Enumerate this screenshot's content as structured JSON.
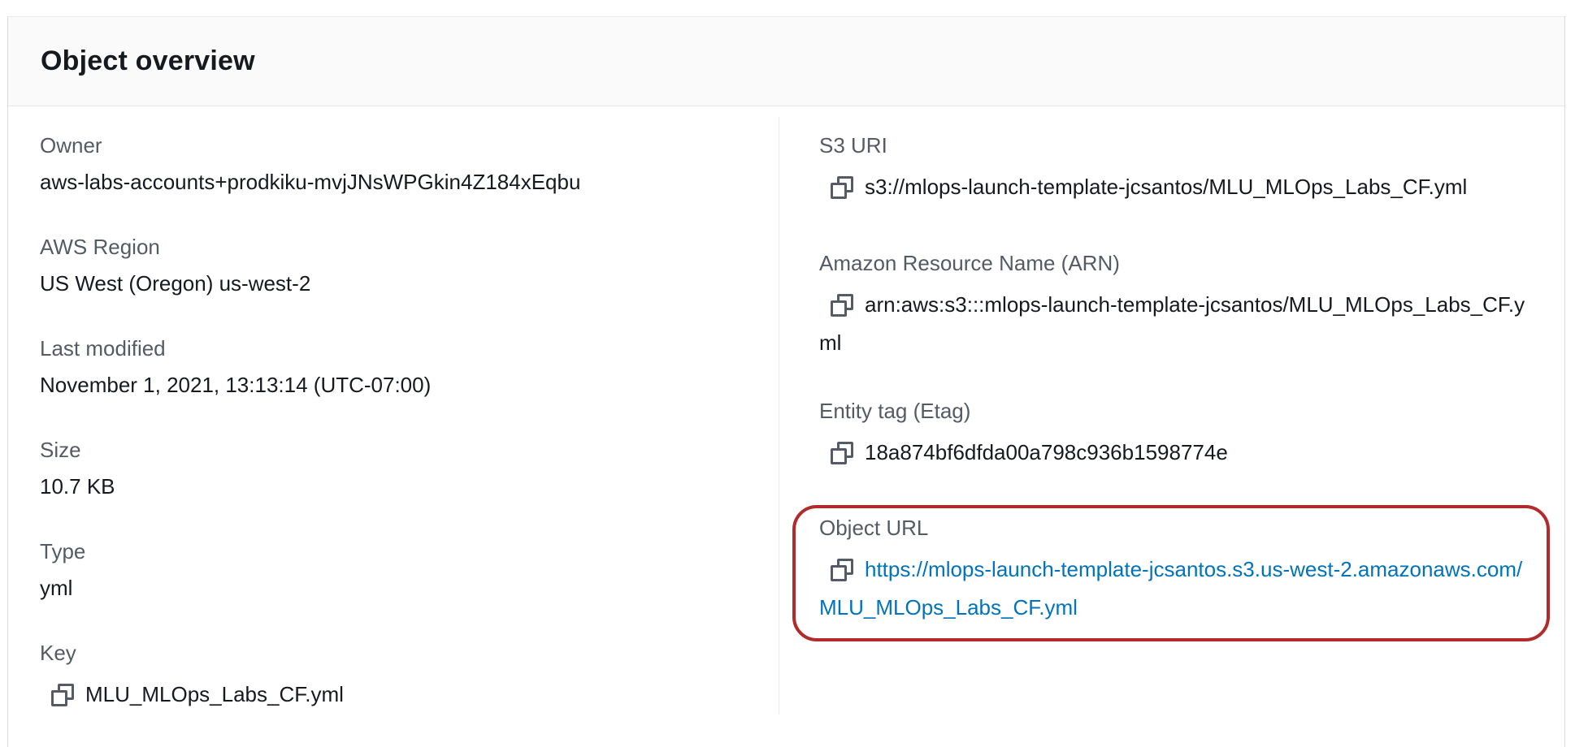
{
  "panel": {
    "title": "Object overview"
  },
  "left": {
    "owner": {
      "label": "Owner",
      "value": "aws-labs-accounts+prodkiku-mvjJNsWPGkin4Z184xEqbu"
    },
    "region": {
      "label": "AWS Region",
      "value": "US West (Oregon) us-west-2"
    },
    "last_modified": {
      "label": "Last modified",
      "value": "November 1, 2021, 13:13:14 (UTC-07:00)"
    },
    "size": {
      "label": "Size",
      "value": "10.7 KB"
    },
    "type": {
      "label": "Type",
      "value": "yml"
    },
    "key": {
      "label": "Key",
      "value": "MLU_MLOps_Labs_CF.yml"
    }
  },
  "right": {
    "s3_uri": {
      "label": "S3 URI",
      "value": "s3://mlops-launch-template-jcsantos/MLU_MLOps_Labs_CF.yml"
    },
    "arn": {
      "label": "Amazon Resource Name (ARN)",
      "value": "arn:aws:s3:::mlops-launch-template-jcsantos/MLU_MLOps_Labs_CF.yml"
    },
    "etag": {
      "label": "Entity tag (Etag)",
      "value": "18a874bf6dfda00a798c936b1598774e"
    },
    "object_url": {
      "label": "Object URL",
      "value": "https://mlops-launch-template-jcsantos.s3.us-west-2.amazonaws.com/MLU_MLOps_Labs_CF.yml"
    }
  },
  "icons": {
    "copy": "copy-icon"
  },
  "colors": {
    "link": "#0073bb",
    "highlight": "#b22a2a",
    "label": "#545b64"
  }
}
